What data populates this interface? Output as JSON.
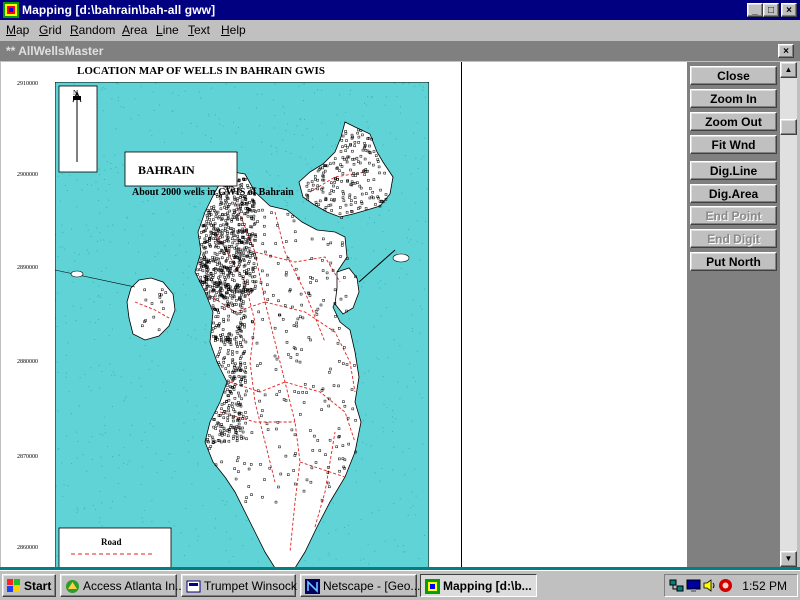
{
  "window": {
    "title": "Mapping [d:\\bahrain\\bah-all gww]",
    "controls": {
      "minimize": "_",
      "maximize": "□",
      "close": "×"
    }
  },
  "menu": [
    "Map",
    "Grid",
    "Random",
    "Area",
    "Line",
    "Text",
    "Help"
  ],
  "child_window": {
    "title": "** AllWellsMaster",
    "close": "×"
  },
  "map": {
    "title": "LOCATION MAP OF WELLS IN BAHRAIN GWIS",
    "box_label": "BAHRAIN",
    "subtitle": "About 2000 wells in GWIS of Bahrain",
    "legend_label": "Road",
    "north_symbol": "N",
    "y_ticks": [
      "2910000",
      "2900000",
      "2890000",
      "2880000",
      "2870000",
      "2860000"
    ],
    "colors": {
      "sea": "#5fd3d6",
      "land": "#ffffff",
      "road": "#e02020",
      "wells": "#000000"
    }
  },
  "toolbar": {
    "buttons": [
      {
        "label": "Close",
        "enabled": true
      },
      {
        "label": "Zoom In",
        "enabled": true
      },
      {
        "label": "Zoom Out",
        "enabled": true
      },
      {
        "label": "Fit Wnd",
        "enabled": true
      },
      {
        "label": "Dig.Line",
        "enabled": true
      },
      {
        "label": "Dig.Area",
        "enabled": true
      },
      {
        "label": "End Point",
        "enabled": false
      },
      {
        "label": "End Digit",
        "enabled": false
      },
      {
        "label": "Put North",
        "enabled": true
      }
    ]
  },
  "taskbar": {
    "start": "Start",
    "tasks": [
      {
        "label": "Access Atlanta In...",
        "icon": "access-atlanta-icon",
        "active": false
      },
      {
        "label": "Trumpet Winsock",
        "icon": "trumpet-winsock-icon",
        "active": false
      },
      {
        "label": "Netscape - [Geo...",
        "icon": "netscape-icon",
        "active": false
      },
      {
        "label": "Mapping [d:\\b...",
        "icon": "mapping-app-icon",
        "active": true
      }
    ],
    "clock": "1:52 PM"
  }
}
